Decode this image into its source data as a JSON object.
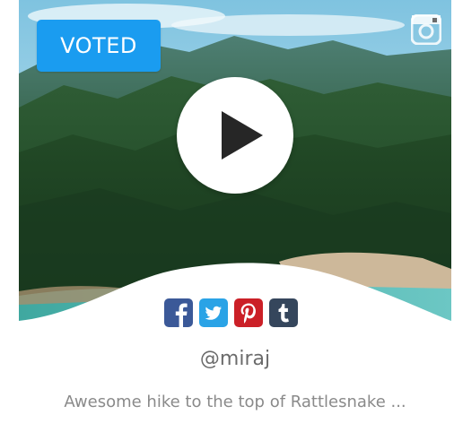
{
  "badge": {
    "label": "VOTED"
  },
  "icons": {
    "instagram": "instagram-icon",
    "play": "play-icon",
    "share": [
      "facebook-icon",
      "twitter-icon",
      "pinterest-icon",
      "tumblr-icon"
    ]
  },
  "colors": {
    "badge": "#1a9cf0",
    "facebook": "#3b5998",
    "twitter": "#2aa3e6",
    "pinterest": "#cb2027",
    "tumblr": "#35465c"
  },
  "post": {
    "username": "@miraj",
    "caption": "Awesome hike to the top of Rattlesnake ..."
  }
}
